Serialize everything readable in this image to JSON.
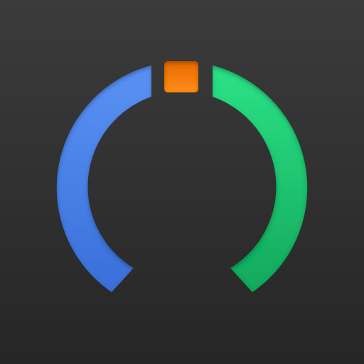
{
  "icon": {
    "name": "gauge-icon",
    "colors": {
      "background_top": "#3a3a3a",
      "background_bottom": "#272727",
      "left_arc": "#4a86ee",
      "left_arc_dark": "#2f62c8",
      "top_marker": "#f07a0a",
      "top_marker_dark": "#c95a00",
      "right_arc": "#22d07a",
      "right_arc_dark": "#129a55"
    }
  }
}
